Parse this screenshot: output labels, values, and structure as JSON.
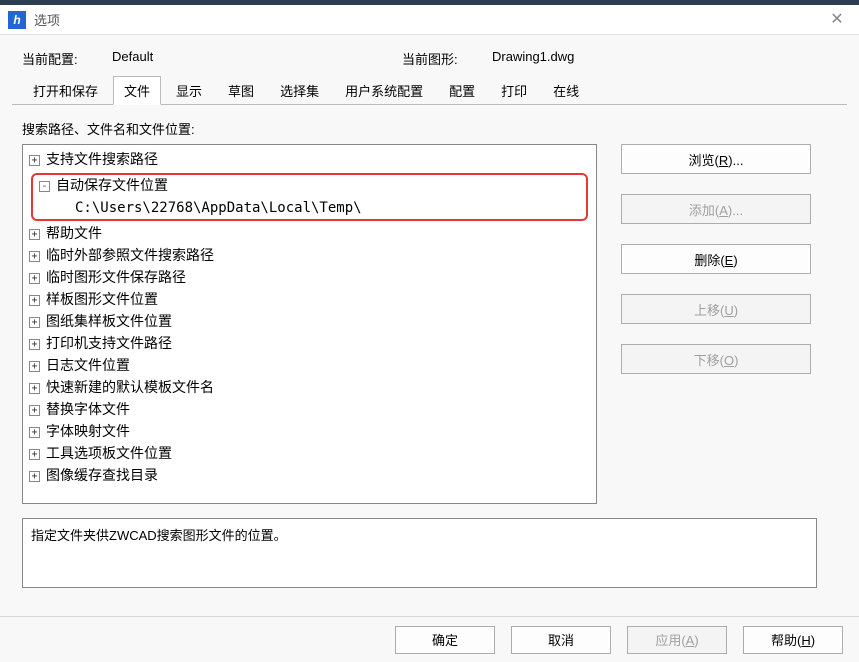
{
  "window": {
    "title": "选项"
  },
  "info": {
    "profile_label": "当前配置:",
    "profile_value": "Default",
    "drawing_label": "当前图形:",
    "drawing_value": "Drawing1.dwg"
  },
  "tabs": {
    "open_save": "打开和保存",
    "file": "文件",
    "display": "显示",
    "draft": "草图",
    "selection": "选择集",
    "user_prefs": "用户系统配置",
    "config": "配置",
    "print": "打印",
    "online": "在线"
  },
  "section_label": "搜索路径、文件名和文件位置:",
  "tree": {
    "items": [
      "支持文件搜索路径",
      "自动保存文件位置",
      "帮助文件",
      "临时外部参照文件搜索路径",
      "临时图形文件保存路径",
      "样板图形文件位置",
      "图纸集样板文件位置",
      "打印机支持文件路径",
      "日志文件位置",
      "快速新建的默认模板文件名",
      "替换字体文件",
      "字体映射文件",
      "工具选项板文件位置",
      "图像缓存查找目录"
    ],
    "expanded_child": "C:\\Users\\22768\\AppData\\Local\\Temp\\"
  },
  "buttons": {
    "browse": "浏览",
    "browse_key": "R",
    "add": "添加",
    "add_key": "A",
    "remove": "删除",
    "remove_key": "E",
    "move_up": "上移",
    "move_up_key": "U",
    "move_down": "下移",
    "move_down_key": "O"
  },
  "description": "指定文件夹供ZWCAD搜索图形文件的位置。",
  "footer": {
    "ok": "确定",
    "cancel": "取消",
    "apply": "应用",
    "apply_key": "A",
    "help": "帮助",
    "help_key": "H"
  }
}
